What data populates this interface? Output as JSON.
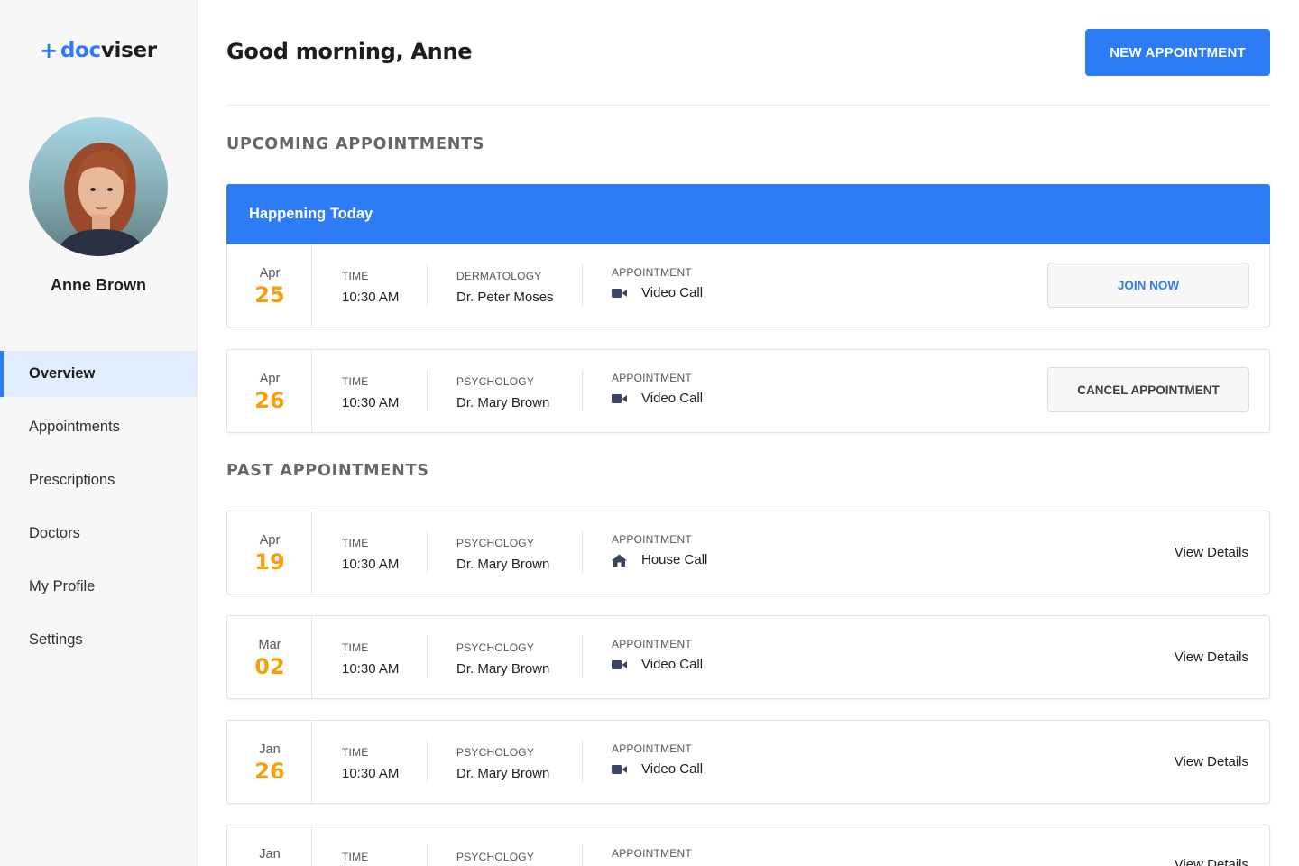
{
  "brand": {
    "plus": "+",
    "part1": "doc",
    "part2": "viser"
  },
  "user": {
    "name": "Anne Brown"
  },
  "nav": [
    {
      "label": "Overview",
      "active": true
    },
    {
      "label": "Appointments",
      "active": false
    },
    {
      "label": "Prescriptions",
      "active": false
    },
    {
      "label": "Doctors",
      "active": false
    },
    {
      "label": "My Profile",
      "active": false
    },
    {
      "label": "Settings",
      "active": false
    }
  ],
  "header": {
    "greeting": "Good morning, Anne",
    "new_appointment_label": "NEW APPOINTMENT"
  },
  "sections": {
    "upcoming": "UPCOMING APPOINTMENTS",
    "past": "PAST APPOINTMENTS",
    "today_banner": "Happening Today"
  },
  "labels": {
    "time": "TIME",
    "appointment": "APPOINTMENT"
  },
  "upcoming": [
    {
      "month": "Apr",
      "day": "25",
      "time": "10:30 AM",
      "specialty": "DERMATOLOGY",
      "doctor": "Dr. Peter Moses",
      "type": "Video Call",
      "type_icon": "video-icon",
      "action": "JOIN NOW"
    },
    {
      "month": "Apr",
      "day": "26",
      "time": "10:30 AM",
      "specialty": "PSYCHOLOGY",
      "doctor": "Dr. Mary Brown",
      "type": "Video Call",
      "type_icon": "video-icon",
      "action": "CANCEL APPOINTMENT"
    }
  ],
  "past": [
    {
      "month": "Apr",
      "day": "19",
      "time": "10:30 AM",
      "specialty": "PSYCHOLOGY",
      "doctor": "Dr. Mary Brown",
      "type": "House Call",
      "type_icon": "home-icon",
      "action": "View Details"
    },
    {
      "month": "Mar",
      "day": "02",
      "time": "10:30 AM",
      "specialty": "PSYCHOLOGY",
      "doctor": "Dr. Mary Brown",
      "type": "Video Call",
      "type_icon": "video-icon",
      "action": "View Details"
    },
    {
      "month": "Jan",
      "day": "26",
      "time": "10:30 AM",
      "specialty": "PSYCHOLOGY",
      "doctor": "Dr. Mary Brown",
      "type": "Video Call",
      "type_icon": "video-icon",
      "action": "View Details"
    },
    {
      "month": "Jan",
      "day": "",
      "time": "",
      "specialty": "PSYCHOLOGY",
      "doctor": "",
      "type": "",
      "type_icon": "",
      "action": "View Details"
    }
  ],
  "colors": {
    "accent": "#2d7cf6",
    "date_day": "#f5a00f",
    "active_nav_bg": "#e0edfe",
    "icon": "#3b4463"
  }
}
